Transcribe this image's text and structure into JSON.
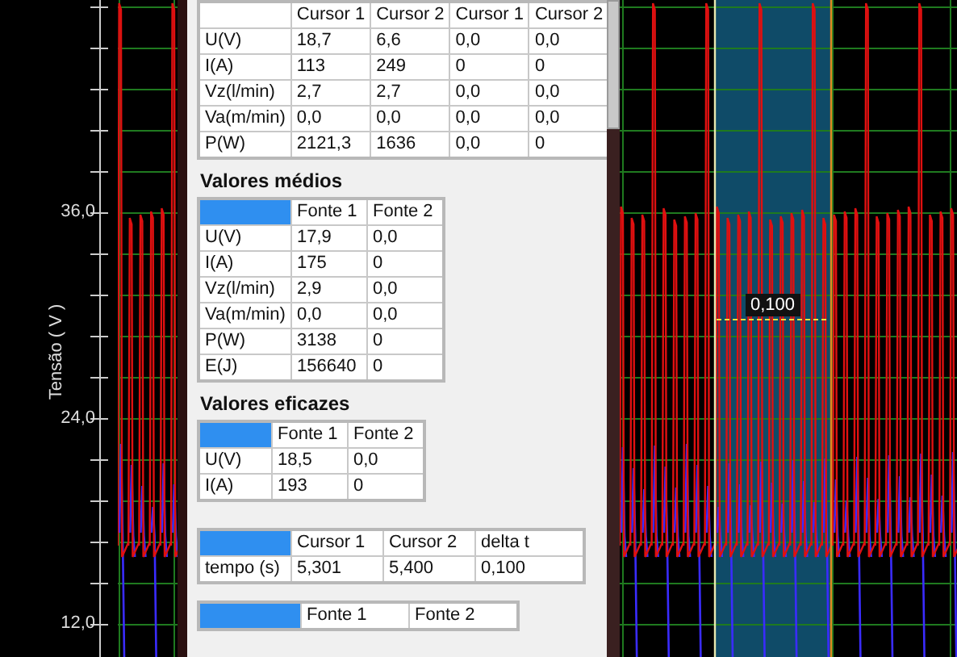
{
  "axis": {
    "title": "Tensão ( V )",
    "ticks": [
      "36,0",
      "24,0",
      "12,0"
    ]
  },
  "cursor": {
    "delta_label": "0,100"
  },
  "cursor_table": {
    "columns": [
      "Cursor 1",
      "Cursor 2",
      "Cursor 1",
      "Cursor 2"
    ],
    "rows": [
      {
        "label": "U(V)",
        "values": [
          "18,7",
          "6,6",
          "0,0",
          "0,0"
        ]
      },
      {
        "label": "I(A)",
        "values": [
          "113",
          "249",
          "0",
          "0"
        ]
      },
      {
        "label": "Vz(l/min)",
        "values": [
          "2,7",
          "2,7",
          "0,0",
          "0,0"
        ]
      },
      {
        "label": "Va(m/min)",
        "values": [
          "0,0",
          "0,0",
          "0,0",
          "0,0"
        ]
      },
      {
        "label": "P(W)",
        "values": [
          "2121,3",
          "1636",
          "0,0",
          "0"
        ]
      }
    ]
  },
  "mean_values": {
    "title": "Valores médios",
    "columns": [
      "Fonte 1",
      "Fonte 2"
    ],
    "rows": [
      {
        "label": "U(V)",
        "values": [
          "17,9",
          "0,0"
        ]
      },
      {
        "label": "I(A)",
        "values": [
          "175",
          "0"
        ]
      },
      {
        "label": "Vz(l/min)",
        "values": [
          "2,9",
          "0,0"
        ]
      },
      {
        "label": "Va(m/min)",
        "values": [
          "0,0",
          "0,0"
        ]
      },
      {
        "label": "P(W)",
        "values": [
          "3138",
          "0"
        ]
      },
      {
        "label": "E(J)",
        "values": [
          "156640",
          "0"
        ]
      }
    ]
  },
  "rms_values": {
    "title": "Valores eficazes",
    "columns": [
      "Fonte 1",
      "Fonte 2"
    ],
    "rows": [
      {
        "label": "U(V)",
        "values": [
          "18,5",
          "0,0"
        ]
      },
      {
        "label": "I(A)",
        "values": [
          "193",
          "0"
        ]
      }
    ]
  },
  "time_table": {
    "columns": [
      "Cursor 1",
      "Cursor 2",
      "delta t"
    ],
    "rows": [
      {
        "label": "tempo (s)",
        "values": [
          "5,301",
          "5,400",
          "0,100"
        ]
      }
    ]
  },
  "bottom_table": {
    "columns": [
      "Fonte 1",
      "Fonte 2"
    ]
  }
}
